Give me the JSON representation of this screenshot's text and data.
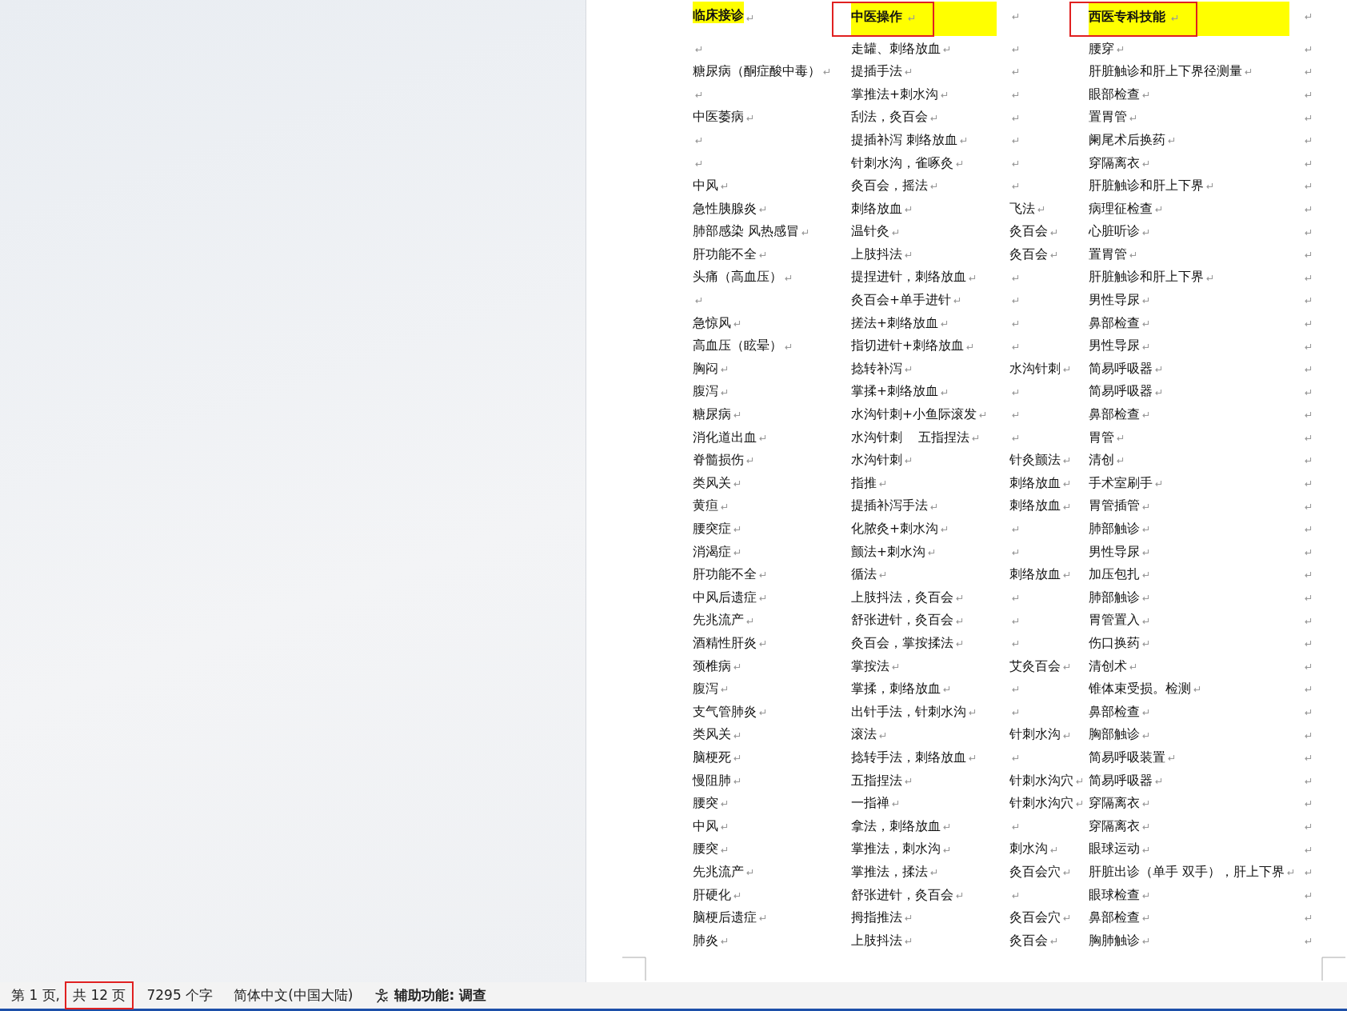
{
  "table": {
    "header": [
      {
        "text": "临床接诊",
        "kind": "marked",
        "annotated": false
      },
      {
        "text": "中医操作",
        "kind": "filled",
        "annotated": true
      },
      {
        "kind": "plain"
      },
      {
        "text": "西医专科技能",
        "kind": "filled",
        "annotated": true
      }
    ],
    "rows": [
      [
        null,
        "走罐、刺络放血",
        null,
        "腰穿"
      ],
      [
        "糖尿病（酮症酸中毒）",
        "提插手法",
        null,
        "肝脏触诊和肝上下界径测量"
      ],
      [
        null,
        "掌推法+刺水沟",
        null,
        "眼部检查"
      ],
      [
        "中医萎病",
        "刮法，灸百会",
        null,
        "置胃管"
      ],
      [
        null,
        "提插补泻 刺络放血",
        null,
        "阑尾术后换药"
      ],
      [
        null,
        "针刺水沟，雀啄灸",
        null,
        "穿隔离衣"
      ],
      [
        "中风",
        "灸百会，摇法",
        null,
        "肝脏触诊和肝上下界"
      ],
      [
        "急性胰腺炎",
        "刺络放血",
        "飞法",
        "病理征检查"
      ],
      [
        "肺部感染 风热感冒",
        "温针灸",
        "灸百会",
        "心脏听诊"
      ],
      [
        "肝功能不全",
        "上肢抖法",
        "灸百会",
        "置胃管"
      ],
      [
        "头痛（高血压）",
        "提捏进针，刺络放血",
        null,
        "肝脏触诊和肝上下界"
      ],
      [
        null,
        "灸百会+单手进针",
        null,
        "男性导尿"
      ],
      [
        "急惊风",
        "搓法+刺络放血",
        null,
        "鼻部检查"
      ],
      [
        "高血压（眩晕）",
        "指切进针+刺络放血",
        null,
        "男性导尿"
      ],
      [
        "胸闷",
        "捻转补泻",
        "水沟针刺",
        "简易呼吸器"
      ],
      [
        "腹泻",
        "掌揉+刺络放血",
        null,
        "简易呼吸器"
      ],
      [
        "糖尿病",
        "水沟针刺+小鱼际滚发",
        null,
        "鼻部检查"
      ],
      [
        "消化道出血",
        "水沟针刺    五指捏法",
        null,
        "胃管"
      ],
      [
        "脊髓损伤",
        "水沟针刺",
        "针灸颤法",
        "清创"
      ],
      [
        "类风关",
        "指推",
        "刺络放血",
        "手术室刷手"
      ],
      [
        "黄疸",
        "提插补泻手法",
        "刺络放血",
        "胃管插管"
      ],
      [
        "腰突症",
        "化脓灸+刺水沟",
        null,
        "肺部触诊"
      ],
      [
        "消渴症",
        "颤法+刺水沟",
        null,
        "男性导尿"
      ],
      [
        "肝功能不全",
        "循法",
        "刺络放血",
        "加压包扎"
      ],
      [
        "中风后遗症",
        "上肢抖法，灸百会",
        null,
        "肺部触诊"
      ],
      [
        "先兆流产",
        "舒张进针，灸百会",
        null,
        "胃管置入"
      ],
      [
        "酒精性肝炎",
        "灸百会，掌按揉法",
        null,
        "伤口换药"
      ],
      [
        "颈椎病",
        "掌按法",
        "艾灸百会",
        "清创术"
      ],
      [
        "腹泻",
        "掌揉，刺络放血",
        null,
        "锥体束受损。检测"
      ],
      [
        "支气管肺炎",
        "出针手法，针刺水沟",
        null,
        "鼻部检查"
      ],
      [
        "类风关",
        "滚法",
        "针刺水沟",
        "胸部触诊"
      ],
      [
        "脑梗死",
        "捻转手法，刺络放血",
        null,
        "简易呼吸装置"
      ],
      [
        "慢阻肺",
        "五指捏法",
        "针刺水沟穴",
        "简易呼吸器"
      ],
      [
        "腰突",
        "一指禅",
        "针刺水沟穴",
        "穿隔离衣"
      ],
      [
        "中风",
        "拿法，刺络放血",
        null,
        "穿隔离衣"
      ],
      [
        "腰突",
        "掌推法，刺水沟",
        "刺水沟",
        "眼球运动"
      ],
      [
        "先兆流产",
        "掌推法，揉法",
        "灸百会穴",
        "肝脏出诊（单手 双手），肝上下界"
      ],
      [
        "肝硬化",
        "舒张进针，灸百会",
        null,
        "眼球检查"
      ],
      [
        "脑梗后遗症",
        "拇指推法",
        "灸百会穴",
        "鼻部检查"
      ],
      [
        "肺炎",
        "上肢抖法",
        "灸百会",
        "胸肺触诊"
      ]
    ]
  },
  "status_bar": [
    {
      "text": "第 1 页,",
      "annotated": false
    },
    {
      "text": "共 12 页",
      "annotated": true
    },
    {
      "text": "7295 个字",
      "annotated": false
    },
    {
      "text": "简体中文(中国大陆)",
      "annotated": false
    },
    {
      "text": "辅助功能: 调查",
      "kind": "accessibility",
      "annotated": false
    }
  ]
}
